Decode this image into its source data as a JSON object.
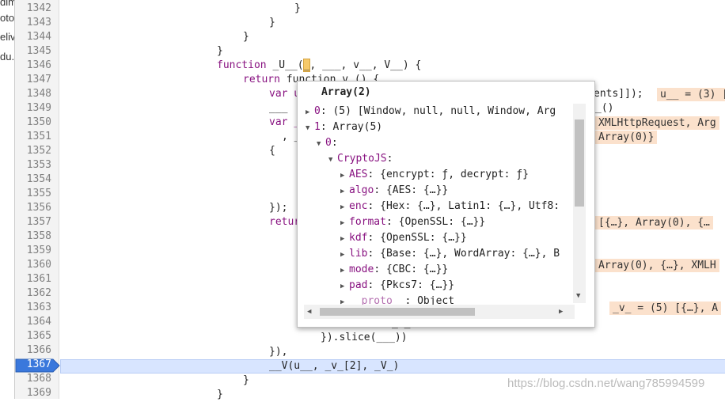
{
  "left_snippets": [
    "dim",
    "oto",
    "eliv",
    "du."
  ],
  "line_numbers": [
    "1342",
    "1343",
    "1344",
    "1345",
    "1346",
    "1347",
    "1348",
    "1349",
    "1350",
    "1351",
    "1352",
    "1353",
    "1354",
    "1355",
    "1356",
    "1357",
    "1358",
    "1359",
    "1360",
    "1361",
    "1362",
    "1363",
    "1364",
    "1365",
    "1366",
    "1367",
    "1368",
    "1369"
  ],
  "current_line": "1367",
  "code": {
    "l1342": "}",
    "l1343": "}",
    "l1344": "}",
    "l1345": "}",
    "l1346_kw": "function",
    "l1346_pre": " _U__(",
    "l1346_hl": "_",
    "l1346_post": ", ___, v__, V__) {",
    "l1347_kw": "return",
    "l1347_rest": " function v_() {",
    "l1348": "var u",
    "l1349": "___",
    "l1350": "var _",
    "l1351": ", _",
    "l1352": "{",
    "l1356": "});",
    "l1357": "retur",
    "l1364": "_[_[2]",
    "l1365": "}).slice(___))",
    "l1366": "}),",
    "l1367": "__V(u__, _v_[2], _V_)",
    "l1368": "}",
    "l1369": "}"
  },
  "right_fragments": {
    "r1348": "ents]]);",
    "r1349": "_()",
    "r1351": "Array(0)}"
  },
  "badges": {
    "b1348": "u__ = (3) [",
    "b1350": "XMLHttpRequest, Arg",
    "b1357": "[{…}, Array(0), {…",
    "b1360": "Array(0), {…}, XMLH",
    "b1363": "_v_ = (5) [{…}, A"
  },
  "popover": {
    "title": "Array(2)",
    "rows": [
      {
        "key": "0",
        "value": ": (5) [Window, null, null, Window, Arg"
      },
      {
        "key": "1",
        "value": ": Array(5)"
      },
      {
        "key": "0",
        "value": ":"
      },
      {
        "key": "CryptoJS",
        "value": ":"
      },
      {
        "key": "AES",
        "value": ": {encrypt: ƒ, decrypt: ƒ}"
      },
      {
        "key": "algo",
        "value": ": {AES: {…}}"
      },
      {
        "key": "enc",
        "value": ": {Hex: {…}, Latin1: {…}, Utf8:"
      },
      {
        "key": "format",
        "value": ": {OpenSSL: {…}}"
      },
      {
        "key": "kdf",
        "value": ": {OpenSSL: {…}}"
      },
      {
        "key": "lib",
        "value": ": {Base: {…}, WordArray: {…}, B"
      },
      {
        "key": "mode",
        "value": ": {CBC: {…}}"
      },
      {
        "key": "pad",
        "value": ": {Pkcs7: {…}}"
      },
      {
        "key": "__proto__",
        "value": ": Object"
      }
    ]
  },
  "watermark": "https://blog.csdn.net/wang785994599"
}
